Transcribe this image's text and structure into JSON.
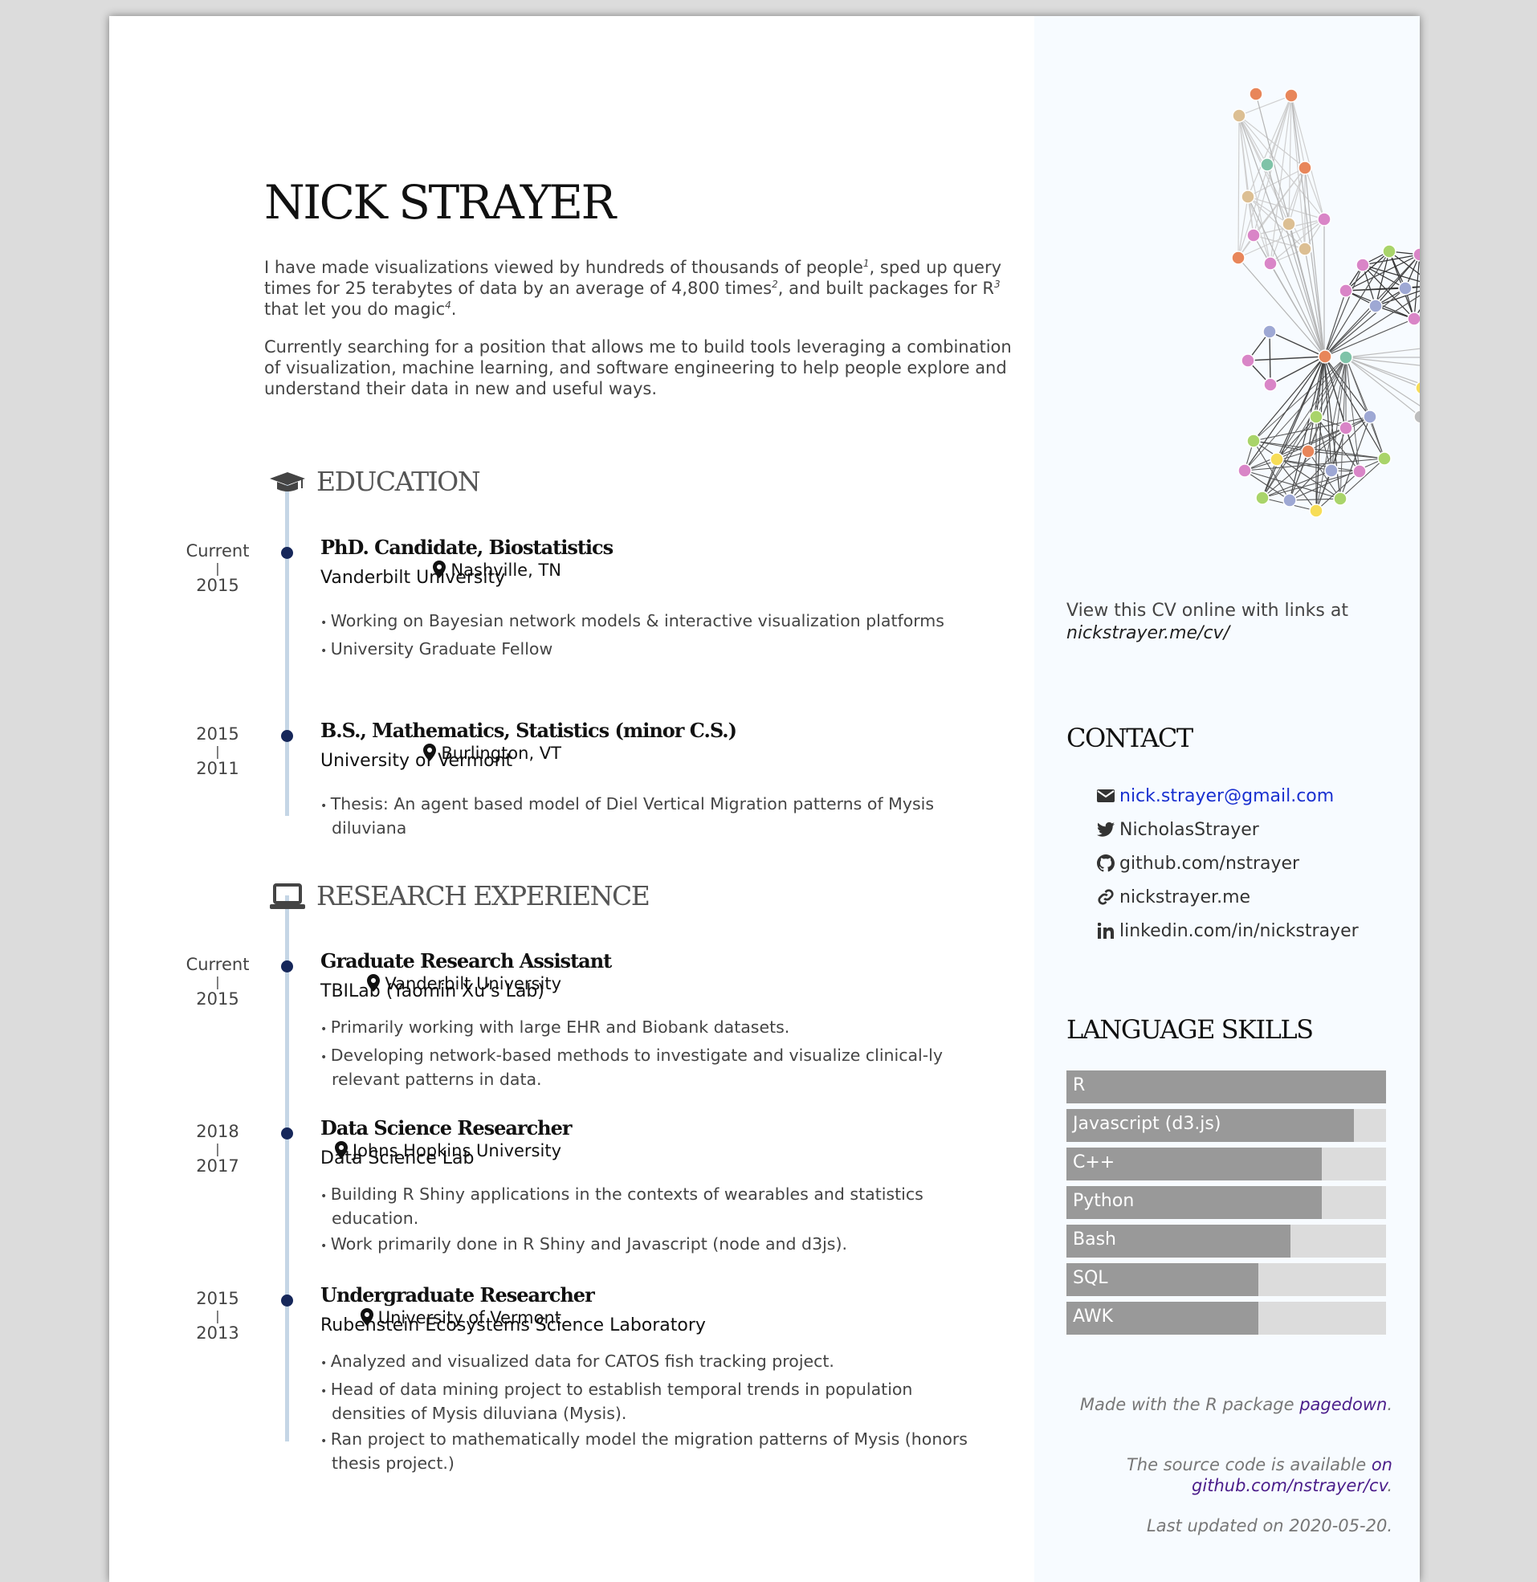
{
  "header": {
    "name": "NICK STRAYER",
    "intro1": {
      "a": "I have made visualizations viewed by hundreds of thousands of people",
      "n1": "1",
      "b": ", sped up query times for 25 terabytes of data by an average of 4,800 times",
      "n2": "2",
      "c": ", and built packages for R",
      "n3": "3",
      "d": " that let you do magic",
      "n4": "4",
      "e": "."
    },
    "intro2": "Currently searching for a position that allows me to build tools leveraging a combination of visualization, machine learning, and software engineering to help people explore and understand their data in new and useful ways."
  },
  "education": {
    "title": "EDUCATION",
    "entries": [
      {
        "end": "Current",
        "sep": "|",
        "start": "2015",
        "title": "PhD. Candidate, Biostatistics",
        "org": "Vanderbilt University",
        "location": "Nashville, TN",
        "bullets": [
          "Working on Bayesian network models & interactive visualization platforms",
          "University Graduate Fellow"
        ]
      },
      {
        "end": "2015",
        "sep": "|",
        "start": "2011",
        "title": "B.S., Mathematics, Statistics (minor C.S.)",
        "org": "University of Vermont",
        "location": "Burlington, VT",
        "bullets": [
          "Thesis: An agent based model of Diel Vertical Migration patterns of Mysis diluviana"
        ]
      }
    ]
  },
  "research": {
    "title": "RESEARCH EXPERIENCE",
    "entries": [
      {
        "end": "Current",
        "sep": "|",
        "start": "2015",
        "title": "Graduate Research Assistant",
        "org": "TBILab (Yaomin Xu’s Lab)",
        "location": "Vanderbilt University",
        "bullets": [
          "Primarily working with large EHR and Biobank datasets.",
          "Developing network-based methods to investigate and visualize clinical-ly relevant patterns in data."
        ]
      },
      {
        "end": "2018",
        "sep": "|",
        "start": "2017",
        "title": "Data Science Researcher",
        "org": "Data Science Lab",
        "location": "Johns Hopkins University",
        "bullets": [
          "Building R Shiny applications in the contexts of wearables and statistics education.",
          "Work primarily done in R Shiny and Javascript (node and d3js)."
        ]
      },
      {
        "end": "2015",
        "sep": "|",
        "start": "2013",
        "title": "Undergraduate Researcher",
        "org": "Rubenstein Ecosystems Science Laboratory",
        "location": "University of Vermont",
        "bullets": [
          "Analyzed and visualized data for CATOS fish tracking project.",
          "Head of data mining project to establish temporal trends in population densities of Mysis diluviana (Mysis).",
          "Ran project to mathematically model the migration patterns of Mysis (honors thesis project.)"
        ]
      }
    ]
  },
  "aside": {
    "view_online": "View this CV online with links at",
    "view_url": "nickstrayer.me/cv/",
    "contact_title": "CONTACT",
    "contacts": [
      {
        "icon": "envelope-icon",
        "text": "nick.strayer@gmail.com"
      },
      {
        "icon": "twitter-icon",
        "text": "NicholasStrayer"
      },
      {
        "icon": "github-icon",
        "text": "github.com/nstrayer"
      },
      {
        "icon": "link-icon",
        "text": "nickstrayer.me"
      },
      {
        "icon": "linkedin-icon",
        "text": "linkedin.com/in/nickstrayer"
      }
    ],
    "skills_title": "LANGUAGE SKILLS",
    "skills": [
      {
        "name": "R",
        "level": 1.0
      },
      {
        "name": "Javascript (d3.js)",
        "level": 0.9
      },
      {
        "name": "C++",
        "level": 0.8
      },
      {
        "name": "Python",
        "level": 0.8
      },
      {
        "name": "Bash",
        "level": 0.7
      },
      {
        "name": "SQL",
        "level": 0.6
      },
      {
        "name": "AWK",
        "level": 0.6
      }
    ],
    "made_with": "Made with the R package",
    "made_with_link": "pagedown",
    "source_text": "The source code is available",
    "source_link": "on github.com/nstrayer/cv",
    "updated": "Last updated on 2020-05-20."
  },
  "colors": {
    "timeline": "#c5d6e6",
    "dot": "#16275a",
    "aside_bg": "#f7fbff",
    "link": "#1a30d0",
    "footer_link": "#4b1d8a",
    "skill_fill": "#999999",
    "skill_bg": "#dcdcdc",
    "network_nodes": [
      "#e8865a",
      "#dcbf93",
      "#7fc3a8",
      "#d985c7",
      "#9ea8d4",
      "#a9d46a",
      "#f7dd57",
      "#bdbdbd"
    ]
  }
}
